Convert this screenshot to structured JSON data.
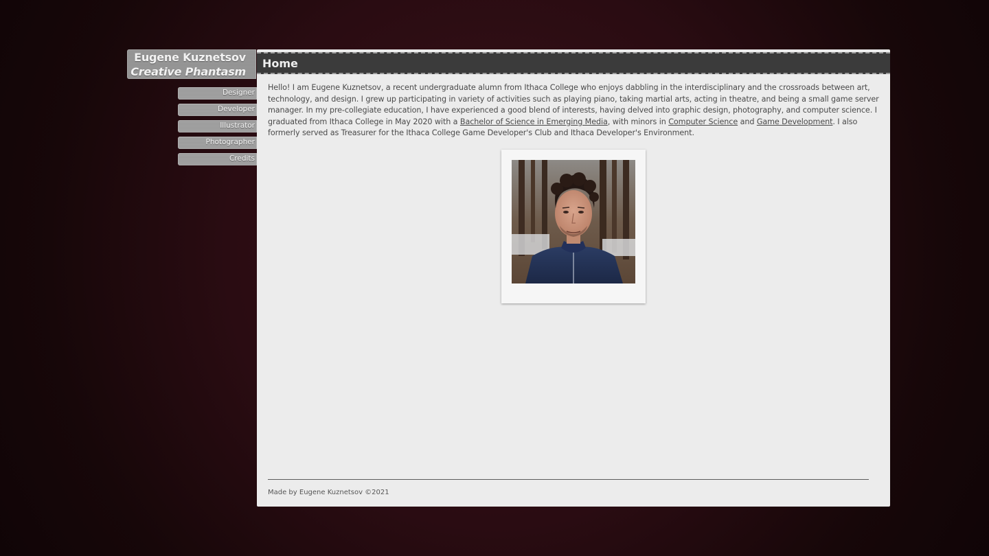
{
  "site": {
    "name": "Eugene Kuznetsov",
    "tagline": "Creative Phantasm"
  },
  "nav": {
    "items": [
      {
        "label": "Designer"
      },
      {
        "label": "Developer"
      },
      {
        "label": "Illustrator"
      },
      {
        "label": "Photographer"
      },
      {
        "label": "Credits"
      }
    ]
  },
  "page": {
    "title": "Home",
    "intro": {
      "part1": "Hello! I am Eugene Kuznetsov, a recent undergraduate alumn from Ithaca College who enjoys dabbling in the interdisciplinary and the crossroads between art, technology, and design. I grew up participating in variety of activities such as playing piano, taking martial arts, acting in theatre, and being a small game server manager. In my pre-collegiate education, I have experienced a good blend of interests, having delved into graphic design, photography, and computer science. I graduated from Ithaca College in May 2020 with a ",
      "link1": "Bachelor of Science in Emerging Media",
      "part2": ", with minors in ",
      "link2": "Computer Science",
      "part3": " and ",
      "link3": "Game Development",
      "part4": ". I also formerly served as Treasurer for the Ithaca College Game Developer's Club and Ithaca Developer's Environment."
    }
  },
  "footer": {
    "text": "Made by Eugene Kuznetsov ©2021"
  },
  "colors": {
    "background": "#2a0c12",
    "panel": "#ececec",
    "header": "#3b3b3b",
    "nav_tab": "#9e9e9e",
    "text": "#4a4a4a"
  }
}
